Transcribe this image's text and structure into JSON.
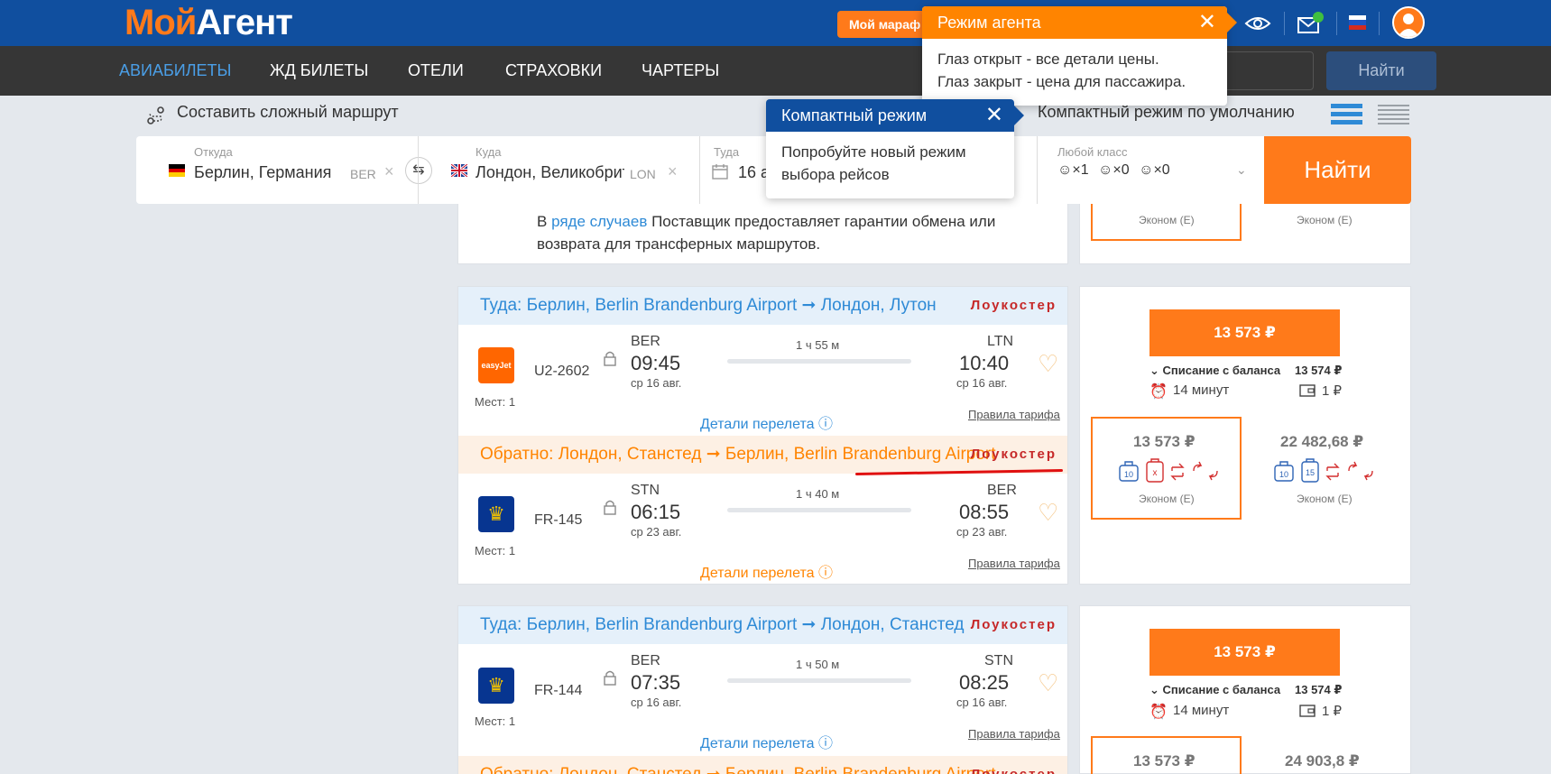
{
  "header": {
    "logo_part1": "Мой",
    "logo_part2": "Агент",
    "marathon_label": "Мой мараф"
  },
  "nav": {
    "items": [
      "АВИАБИЛЕТЫ",
      "ЖД БИЛЕТЫ",
      "ОТЕЛИ",
      "СТРАХОВКИ",
      "ЧАРТЕРЫ"
    ],
    "search_button": "Найти"
  },
  "toolbar": {
    "complex_route": "Составить сложный маршрут",
    "compact_default": "Компактный режим по умолчанию"
  },
  "search": {
    "from_label": "Откуда",
    "from_value": "Берлин, Германия",
    "from_code": "BER",
    "to_label": "Куда",
    "to_value": "Лондон, Великобритания",
    "to_code": "LON",
    "date_label": "Туда",
    "date_value": "16 а",
    "class_label": "Любой класс",
    "adults": "×1",
    "children": "×0",
    "infants": "×0",
    "find_button": "Найти"
  },
  "prev_card": {
    "note_prefix": "В ",
    "note_link": "ряде случаев",
    "note_rest": " Поставщик предоставляет гарантии обмена или возврата для трансферных маршрутов.",
    "fare_class_1": "Эконом (E)",
    "fare_class_2": "Эконом (E)"
  },
  "offers": [
    {
      "out_header": "Туда: Берлин, Berlin Brandenburg Airport ➞ Лондон, Лутон",
      "out_badge": "Лоукостер",
      "out_logo": "easyJet",
      "out_flight": "U2-2602",
      "out_seats": "Мест: 1",
      "out_dep_code": "BER",
      "out_dep_time": "09:45",
      "out_dep_date": "ср 16 авг.",
      "out_duration": "1 ч 55 м",
      "out_arr_code": "LTN",
      "out_arr_time": "10:40",
      "out_arr_date": "ср 16 авг.",
      "out_details": "Детали перелета ⓘ",
      "out_rules": "Правила тарифа",
      "ret_header": "Обратно: Лондон, Станстед ➞ Берлин, Berlin Brandenburg Airport",
      "ret_badge": "Лоукостер",
      "ret_flight": "FR-145",
      "ret_seats": "Мест: 1",
      "ret_dep_code": "STN",
      "ret_dep_time": "06:15",
      "ret_dep_date": "ср 23 авг.",
      "ret_duration": "1 ч 40 м",
      "ret_arr_code": "BER",
      "ret_arr_time": "08:55",
      "ret_arr_date": "ср 23 авг.",
      "ret_details": "Детали перелета ⓘ",
      "ret_rules": "Правила тарифа",
      "price": "13 573 ₽",
      "balance_label": "Списание с баланса",
      "balance_amount": "13 574 ₽",
      "timer": "14 минут",
      "wallet": "1 ₽",
      "fare1_price": "13 573 ₽",
      "fare1_class": "Эконом (E)",
      "fare2_price": "22 482,68 ₽",
      "fare2_class": "Эконом (E)"
    },
    {
      "out_header": "Туда: Берлин, Berlin Brandenburg Airport ➞ Лондон, Станстед",
      "out_badge": "Лоукостер",
      "out_flight": "FR-144",
      "out_seats": "Мест: 1",
      "out_dep_code": "BER",
      "out_dep_time": "07:35",
      "out_dep_date": "ср 16 авг.",
      "out_duration": "1 ч 50 м",
      "out_arr_code": "STN",
      "out_arr_time": "08:25",
      "out_arr_date": "ср 16 авг.",
      "out_details": "Детали перелета ⓘ",
      "out_rules": "Правила тарифа",
      "ret_header": "Обратно: Лондон, Станстед ➞ Берлин, Berlin Brandenburg Airport",
      "ret_badge": "Лоукостер",
      "price": "13 573 ₽",
      "balance_label": "Списание с баланса",
      "balance_amount": "13 574 ₽",
      "timer": "14 минут",
      "wallet": "1 ₽",
      "fare1_price": "13 573 ₽",
      "fare2_price": "24 903,8 ₽"
    }
  ],
  "baggage": {
    "hand": "10",
    "checked_none": "x",
    "checked": "15"
  },
  "tooltips": {
    "agent_title": "Режим агента",
    "agent_line1": "Глаз открыт - все детали цены.",
    "agent_line2": "Глаз закрыт - цена для пассажира.",
    "compact_title": "Компактный режим",
    "compact_text": "Попробуйте новый режим выбора рейсов",
    "close": "✕"
  },
  "colors": {
    "brand_blue": "#104f9f",
    "accent_orange": "#ff7a1a",
    "lowcost_red": "#c62828",
    "link_blue": "#2e8ad6"
  }
}
